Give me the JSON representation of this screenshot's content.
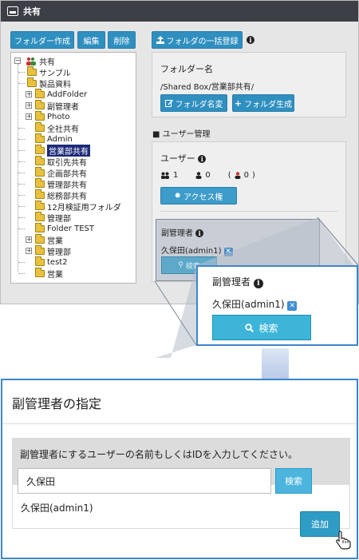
{
  "window": {
    "title": "共有"
  },
  "toolbar": {
    "create_folder": "フォルダー作成",
    "edit": "編集",
    "delete": "削除",
    "bulk_register": "フォルダの一括登録"
  },
  "tree": {
    "root": "共有",
    "items": [
      "サンプル",
      "製品資料",
      "AddFolder",
      "副管理者",
      "Photo",
      "全社共有",
      "Admin",
      "営業部共有",
      "取引先共有",
      "企画部共有",
      "管理部共有",
      "総務部共有",
      "12月検証用フォルダ",
      "管理部",
      "Folder TEST",
      "営業",
      "管理部",
      "test2",
      "営業"
    ]
  },
  "folder_panel": {
    "label": "フォルダー名",
    "path": "/Shared Box/営業部共有/",
    "rename_btn": "フォルダ名変",
    "create_btn": "フォルダ生成"
  },
  "user_mgmt": {
    "heading": "ユーザー管理",
    "users_label": "ユーザー",
    "count_group": "1",
    "count_user": "0",
    "count_admin": "0",
    "access_btn": "アクセス権"
  },
  "sub_admin": {
    "label": "副管理者",
    "user": "久保田(admin1)",
    "search_btn_small": "検索"
  },
  "zoom": {
    "label": "副管理者",
    "user": "久保田(admin1)",
    "search_btn": "検索"
  },
  "dialog": {
    "title": "副管理者の指定",
    "instruction": "副管理者にするユーザーの名前もしくはIDを入力してください。",
    "input_value": "久保田",
    "search_btn": "検索",
    "result_user": "久保田(admin1)",
    "add_btn": "追加"
  },
  "colors": {
    "accent": "#2f8fbf",
    "callout": "#3f85c8",
    "search": "#3db5d8",
    "titlebar": "#3c3f45"
  },
  "icons": [
    "drive-icon",
    "upload-icon",
    "info-icon",
    "edit-icon",
    "plus-icon",
    "group-icon",
    "user-icon",
    "admin-user-icon",
    "gear-icon",
    "close-icon",
    "search-icon",
    "arrow-down-icon",
    "pointer-cursor-icon"
  ]
}
